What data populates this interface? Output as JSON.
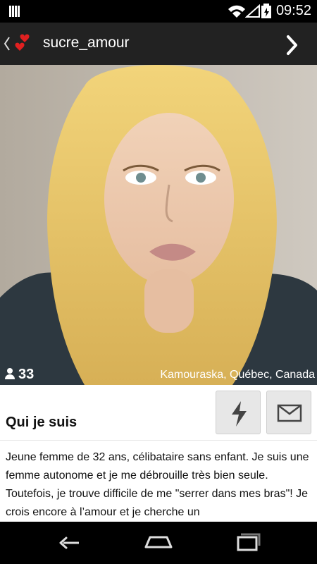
{
  "status_bar": {
    "time": "09:52"
  },
  "action_bar": {
    "title": "sucre_amour"
  },
  "photo": {
    "count": "33",
    "location": "Kamouraska, Québec, Canada"
  },
  "about": {
    "title": "Qui je suis",
    "text": "Jeune femme de 32 ans, célibataire sans enfant. Je suis une femme autonome et je me débrouille très bien seule. Toutefois, je trouve difficile de me \"serrer dans mes bras\"! Je crois encore à l’amour et je cherche un"
  },
  "icons": {
    "status_left": "signal-icon",
    "wifi": "wifi-icon",
    "battery": "battery-icon",
    "back": "back-icon",
    "hearts": "hearts-icon",
    "next": "chevron-right-icon",
    "person": "person-icon",
    "flash": "lightning-icon",
    "mail": "mail-icon",
    "nav_back": "back-icon",
    "nav_home": "home-icon",
    "nav_recents": "recents-icon"
  },
  "colors": {
    "actionbar": "#222222",
    "heart": "#e02020"
  }
}
